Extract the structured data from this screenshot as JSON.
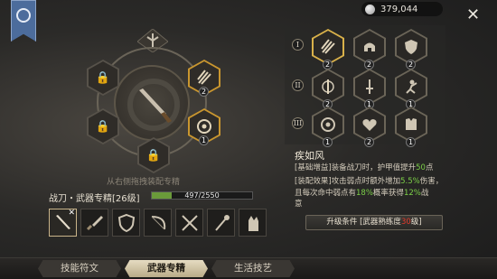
{
  "currency": {
    "amount": "379,044",
    "icon": "silver-coin-icon"
  },
  "wheel": {
    "hint": "从右侧拖拽装配专精",
    "slots": [
      {
        "state": "locked",
        "icon": "lock-icon"
      },
      {
        "state": "locked",
        "icon": "lock-icon"
      },
      {
        "state": "locked",
        "icon": "lock-icon"
      },
      {
        "state": "locked",
        "icon": "lock-icon"
      },
      {
        "state": "equipped",
        "icon": "claw-icon",
        "level": "2"
      },
      {
        "state": "equipped",
        "icon": "shield-target-icon",
        "level": "1"
      }
    ],
    "center_icon": "blade-icon"
  },
  "mastery": {
    "title": "战刀・武器专精[26级]",
    "progress_text": "497/2550",
    "progress": 0.195
  },
  "weapons": [
    "blade",
    "dagger",
    "shield",
    "bow",
    "crossed-blades",
    "staff",
    "gauntlet"
  ],
  "skill_tree": {
    "tiers": [
      "I",
      "II",
      "III"
    ],
    "nodes": [
      {
        "icon": "claw-icon",
        "level": "2",
        "selected": true
      },
      {
        "icon": "helmet-icon",
        "level": "2"
      },
      {
        "icon": "shield-icon",
        "level": "2"
      },
      {
        "icon": "sword-ring-icon",
        "level": "2"
      },
      {
        "icon": "sword-up-icon",
        "level": "1"
      },
      {
        "icon": "fighter-icon",
        "level": "1"
      },
      {
        "icon": "shield-target-icon",
        "level": "1"
      },
      {
        "icon": "heart-icon",
        "level": "2"
      },
      {
        "icon": "chest-armor-icon",
        "level": "1"
      }
    ]
  },
  "skill": {
    "name": "疾如风",
    "line1_pre": "[基础增益]装备战刀时，护甲值提升",
    "line1_val": "50",
    "line1_post": "点",
    "line2_pre": "[装配效果]攻击弱点时额外增加",
    "line2_val": "5.5%",
    "line2_post": "伤害",
    "line3_pre": "，且每次命中弱点有",
    "line3_val1": "18%",
    "line3_mid": "概率获得",
    "line3_val2": "12%",
    "line3_post": "战",
    "line4": "意"
  },
  "upgrade": {
    "pre": "升级条件 [武器熟练度",
    "val": "30",
    "post": "级]"
  },
  "tabs": [
    "技能符文",
    "武器专精",
    "生活技艺"
  ],
  "colors": {
    "accent_gold": "#c9962f",
    "progress_green": "#6a9a3a",
    "highlight_green": "#7ccf48",
    "warning_red": "#e23a2a"
  }
}
